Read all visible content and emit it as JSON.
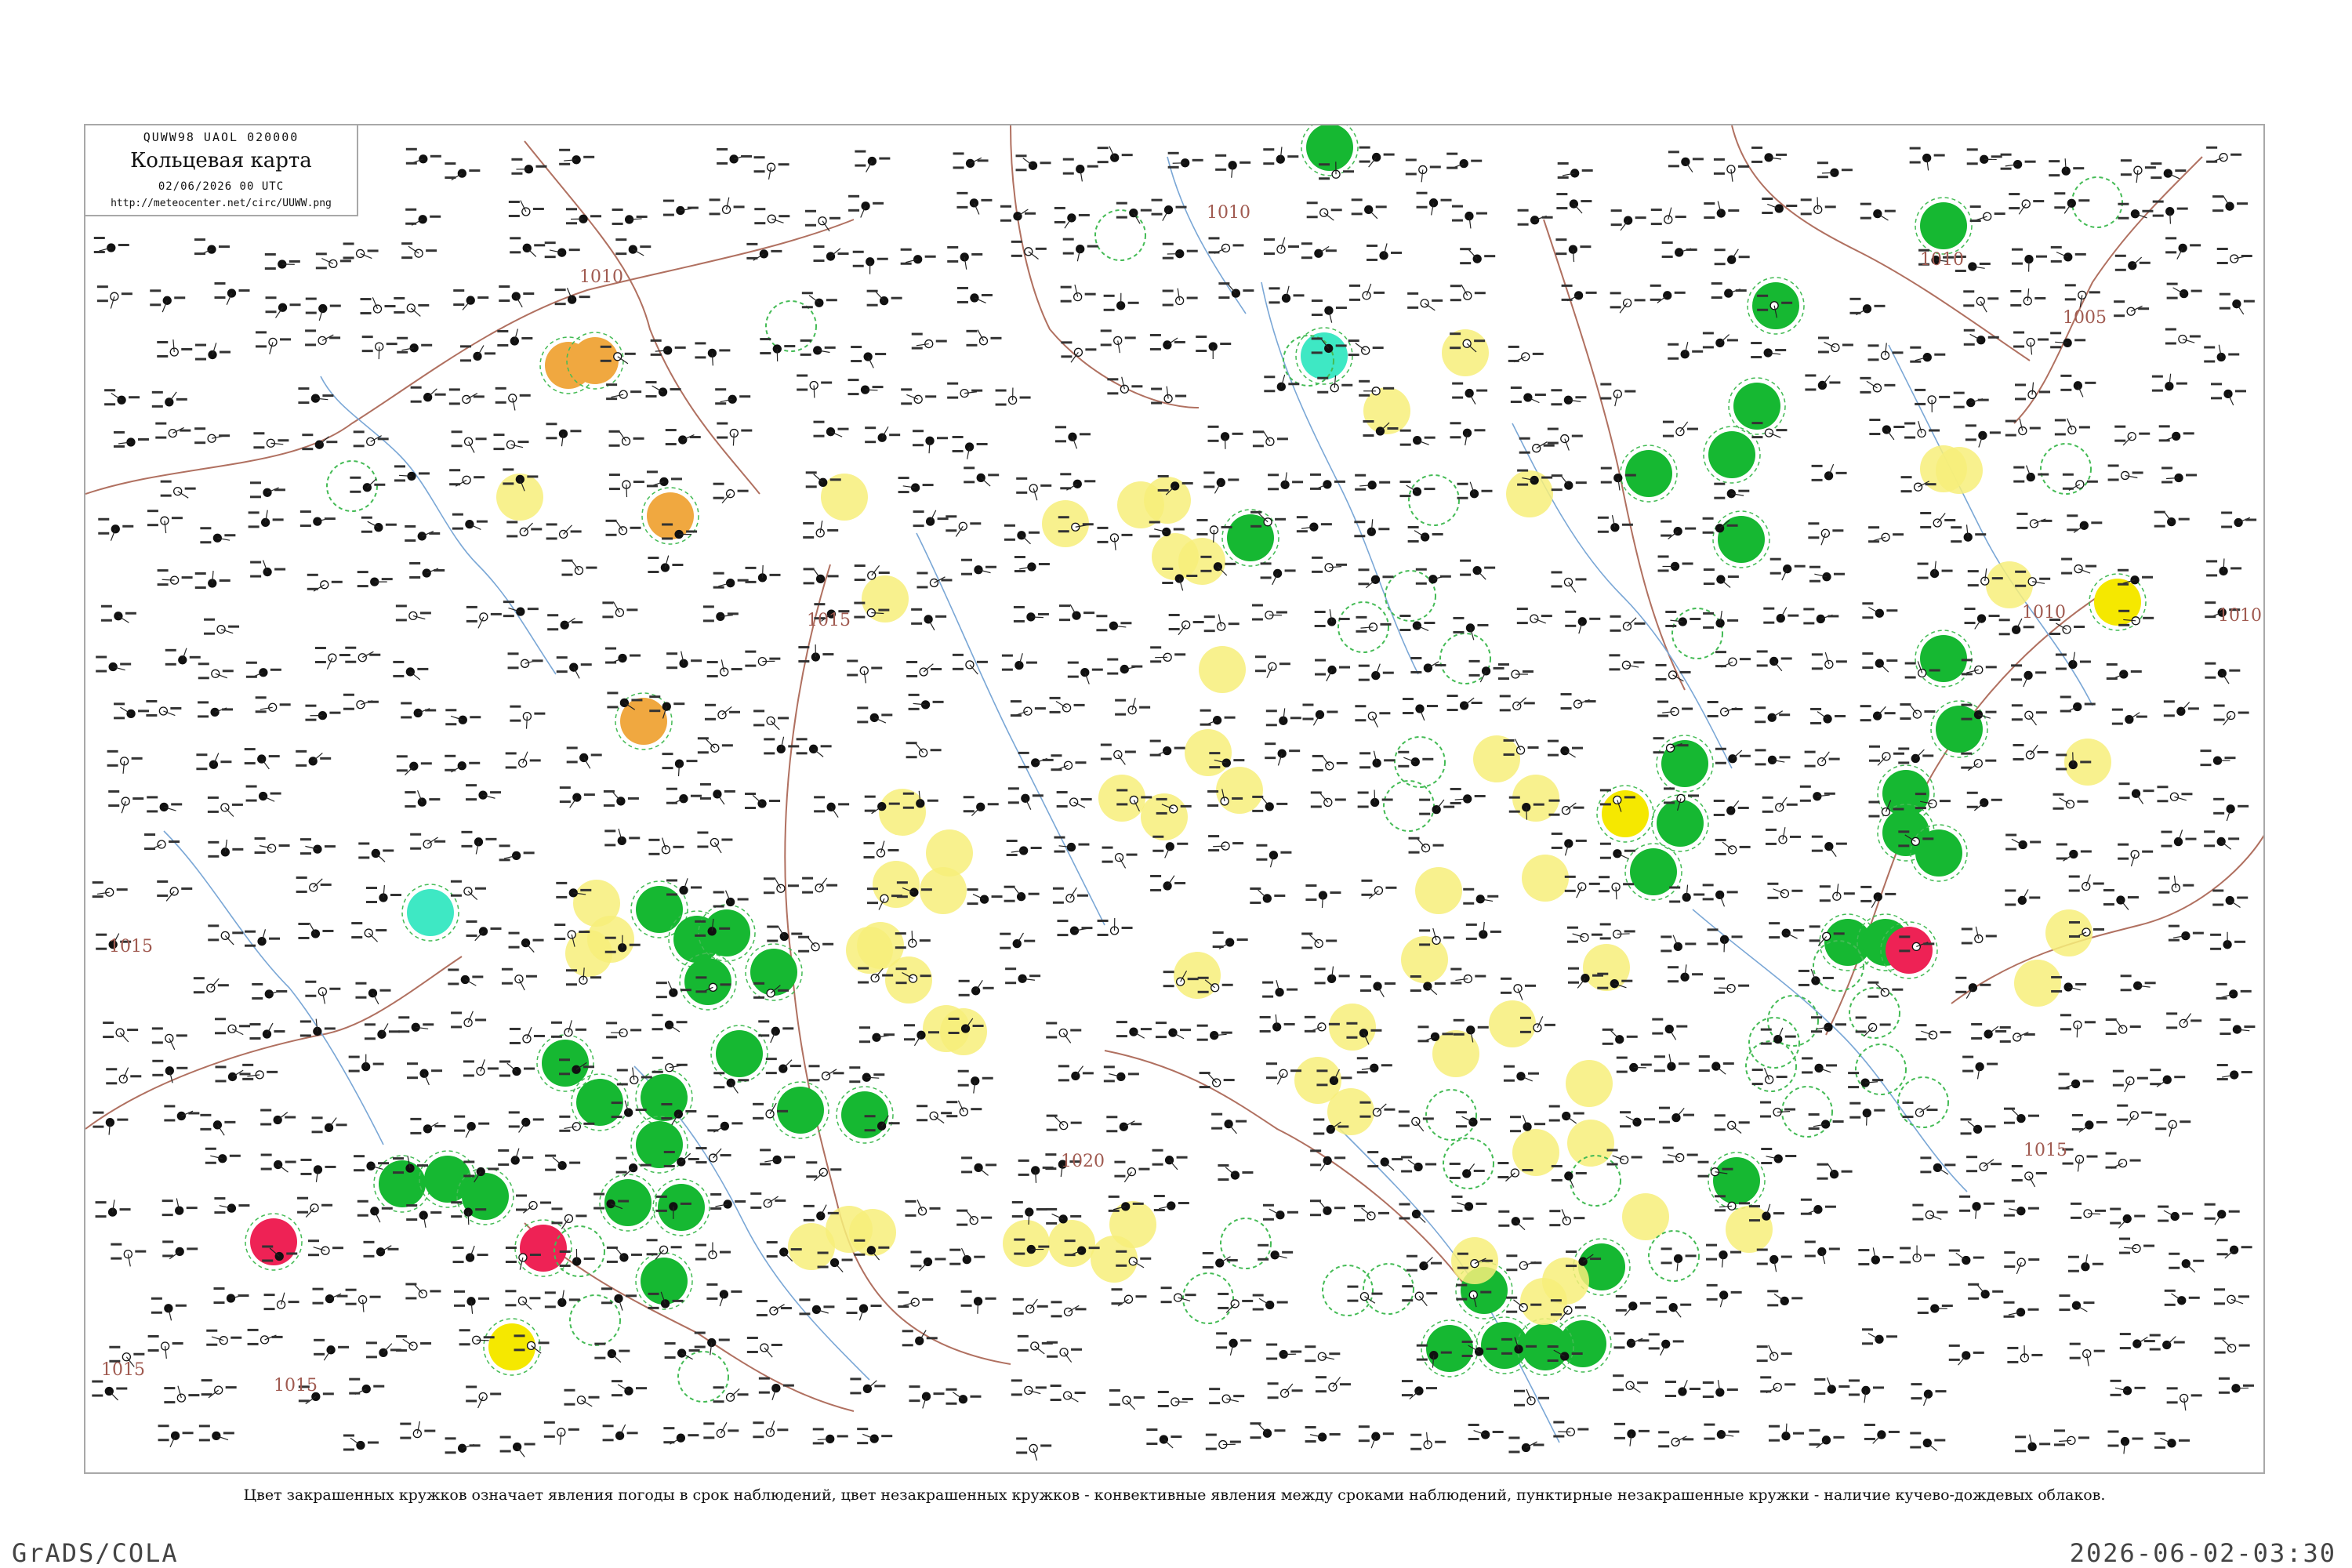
{
  "header": {
    "bulletin_code": "QUWW98  UAOL  020000",
    "title": "Кольцевая карта",
    "datetime": "02/06/2026 00 UTC",
    "url": "http://meteocenter.net/circ/UUWW.png"
  },
  "isobar_labels": [
    "1010",
    "1010",
    "1010",
    "1005",
    "1010",
    "1015",
    "1010",
    "1015",
    "1015",
    "1015",
    "1020",
    "1015"
  ],
  "legend_colors": {
    "thunderstorm_green": "#16b832",
    "shower_yellow": "#f7ee7a",
    "heavy_yellow": "#f5e800",
    "fog_orange": "#f0a840",
    "snow_cyan": "#3ee8c4",
    "severe_red": "#ee2255",
    "dashed_ring": "#44bb55",
    "border": "#b07060",
    "river": "#7aa7d6"
  },
  "caption": "Цвет закрашенных кружков означает явления погоды в срок наблюдений, цвет незакрашенных кружков - конвективные явления между сроками наблюдений, пунктирные незакрашенные кружки - наличие кучево-дождевых облаков.",
  "footer": {
    "left": "GrADS/COLA",
    "right": "2026-06-02-03:30"
  }
}
